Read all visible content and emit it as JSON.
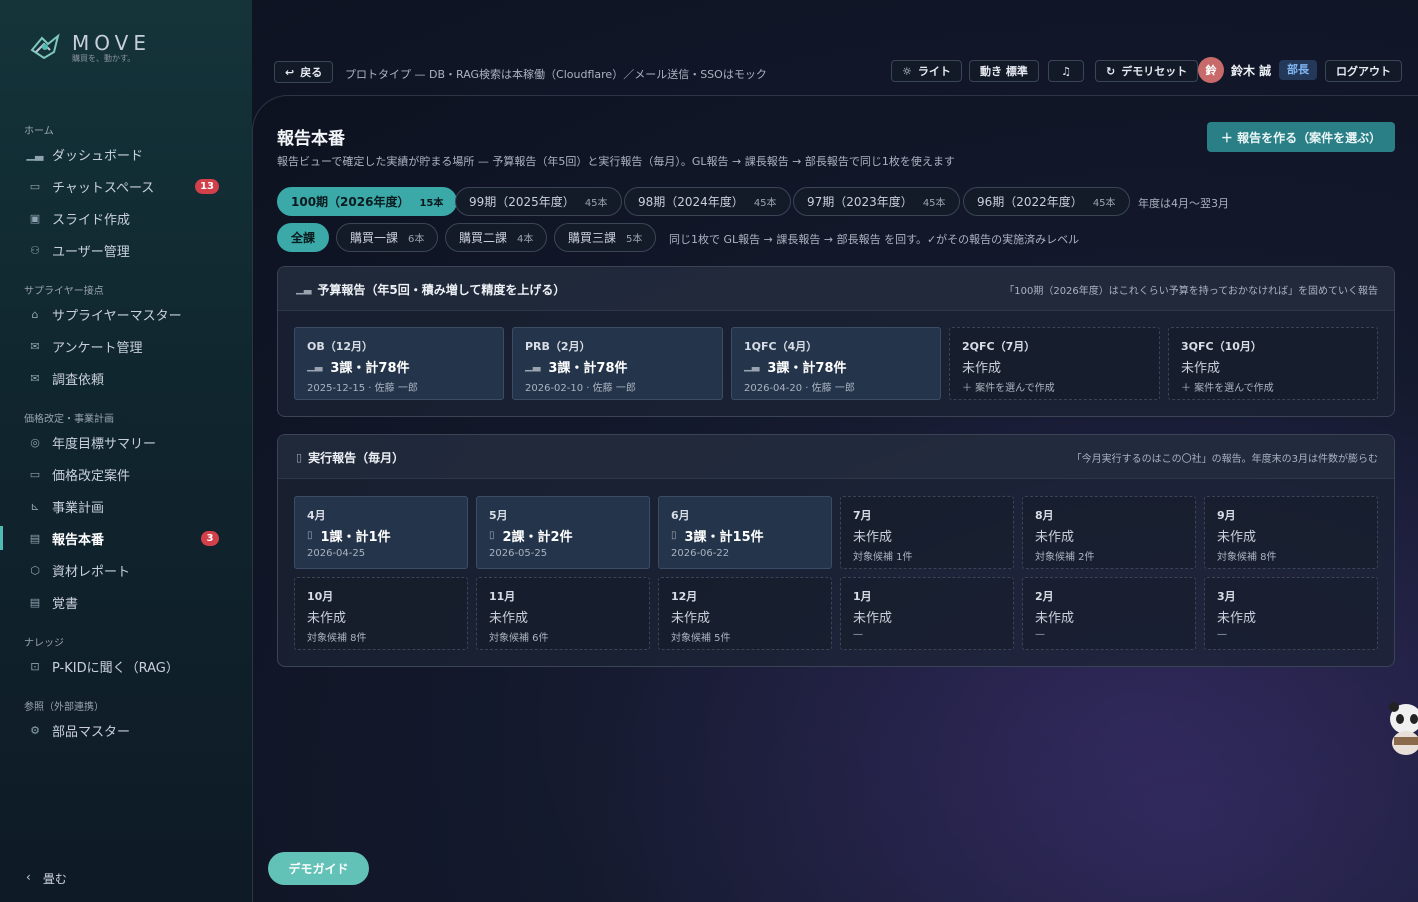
{
  "brand": {
    "name": "MOVE",
    "tagline": "購買を、動かす。"
  },
  "sidebar": {
    "sections": [
      {
        "label": "ホーム",
        "items": [
          {
            "label": "ダッシュボード",
            "icon": "bar-chart-icon"
          },
          {
            "label": "チャットスペース",
            "icon": "chat-icon",
            "badge": "13"
          },
          {
            "label": "スライド作成",
            "icon": "slides-icon"
          },
          {
            "label": "ユーザー管理",
            "icon": "users-icon"
          }
        ]
      },
      {
        "label": "サプライヤー接点",
        "items": [
          {
            "label": "サプライヤーマスター",
            "icon": "factory-icon"
          },
          {
            "label": "アンケート管理",
            "icon": "mail-icon"
          },
          {
            "label": "調査依頼",
            "icon": "envelope-icon"
          }
        ]
      },
      {
        "label": "価格改定・事業計画",
        "items": [
          {
            "label": "年度目標サマリー",
            "icon": "target-icon"
          },
          {
            "label": "価格改定案件",
            "icon": "folder-icon"
          },
          {
            "label": "事業計画",
            "icon": "chart-line-icon"
          },
          {
            "label": "報告本番",
            "icon": "document-icon",
            "badge": "3",
            "active": true
          },
          {
            "label": "資材レポート",
            "icon": "box-icon"
          },
          {
            "label": "覚書",
            "icon": "memo-icon"
          }
        ]
      },
      {
        "label": "ナレッジ",
        "items": [
          {
            "label": "P-KIDに聞く（RAG）",
            "icon": "ai-chat-icon"
          }
        ]
      },
      {
        "label": "参照（外部連携）",
        "items": [
          {
            "label": "部品マスター",
            "icon": "gear-icon"
          }
        ]
      }
    ],
    "collapse_label": "畳む"
  },
  "topbar": {
    "back_label": "戻る",
    "prototype_note": "プロトタイプ — DB・RAG検索は本稼働（Cloudflare）／メール送信・SSOはモック",
    "light_label": "ライト",
    "motion_label": "動き 標準",
    "demo_reset_label": "デモリセット",
    "user_initial": "鈴",
    "user_name": "鈴木 誠",
    "role": "部長",
    "logout_label": "ログアウト"
  },
  "page": {
    "title": "報告本番",
    "description": "報告ビューで確定した実績が貯まる場所 — 予算報告（年5回）と実行報告（毎月）。GL報告 → 課長報告 → 部長報告で同じ1枚を使えます",
    "create_button": "＋ 報告を作る（案件を選ぶ）",
    "periods": [
      {
        "label": "100期（2026年度）",
        "count": "15本",
        "active": true
      },
      {
        "label": "99期（2025年度）",
        "count": "45本"
      },
      {
        "label": "98期（2024年度）",
        "count": "45本"
      },
      {
        "label": "97期（2023年度）",
        "count": "45本"
      },
      {
        "label": "96期（2022年度）",
        "count": "45本"
      }
    ],
    "period_note": "年度は4月〜翌3月",
    "departments": [
      {
        "label": "全課",
        "count": "",
        "active": true
      },
      {
        "label": "購買一課",
        "count": "6本"
      },
      {
        "label": "購買二課",
        "count": "4本"
      },
      {
        "label": "購買三課",
        "count": "5本"
      }
    ],
    "department_note": "同じ1枚で GL報告 → 課長報告 → 部長報告 を回す。✓がその報告の実施済みレベル"
  },
  "budget": {
    "title": "予算報告（年5回・積み増して精度を上げる）",
    "note": "「100期（2026年度）はこれくらい予算を持っておかなければ」を固めていく報告",
    "slots": [
      {
        "label": "OB（12月）",
        "main": "3課・計78件",
        "sub": "2025-12-15 · 佐藤 一郎",
        "done": true
      },
      {
        "label": "PRB（2月）",
        "main": "3課・計78件",
        "sub": "2026-02-10 · 佐藤 一郎",
        "done": true
      },
      {
        "label": "1QFC（4月）",
        "main": "3課・計78件",
        "sub": "2026-04-20 · 佐藤 一郎",
        "done": true
      },
      {
        "label": "2QFC（7月）",
        "main": "未作成",
        "sub": "＋ 案件を選んで作成",
        "done": false
      },
      {
        "label": "3QFC（10月）",
        "main": "未作成",
        "sub": "＋ 案件を選んで作成",
        "done": false
      }
    ]
  },
  "execution": {
    "title": "実行報告（毎月）",
    "note": "「今月実行するのはこの〇社」の報告。年度末の3月は件数が膨らむ",
    "slots": [
      {
        "label": "4月",
        "main": "1課・計1件",
        "sub": "2026-04-25",
        "done": true
      },
      {
        "label": "5月",
        "main": "2課・計2件",
        "sub": "2026-05-25",
        "done": true
      },
      {
        "label": "6月",
        "main": "3課・計15件",
        "sub": "2026-06-22",
        "done": true
      },
      {
        "label": "7月",
        "main": "未作成",
        "sub": "対象候補 1件",
        "done": false
      },
      {
        "label": "8月",
        "main": "未作成",
        "sub": "対象候補 2件",
        "done": false
      },
      {
        "label": "9月",
        "main": "未作成",
        "sub": "対象候補 8件",
        "done": false
      },
      {
        "label": "10月",
        "main": "未作成",
        "sub": "対象候補 8件",
        "done": false
      },
      {
        "label": "11月",
        "main": "未作成",
        "sub": "対象候補 6件",
        "done": false
      },
      {
        "label": "12月",
        "main": "未作成",
        "sub": "対象候補 5件",
        "done": false
      },
      {
        "label": "1月",
        "main": "未作成",
        "sub": "—",
        "done": false
      },
      {
        "label": "2月",
        "main": "未作成",
        "sub": "—",
        "done": false
      },
      {
        "label": "3月",
        "main": "未作成",
        "sub": "—",
        "done": false
      }
    ]
  },
  "demo_guide_label": "デモガイド",
  "colors": {
    "accent": "#3aa9a8",
    "badge": "#d2404a",
    "role": "#7fb4f0"
  }
}
